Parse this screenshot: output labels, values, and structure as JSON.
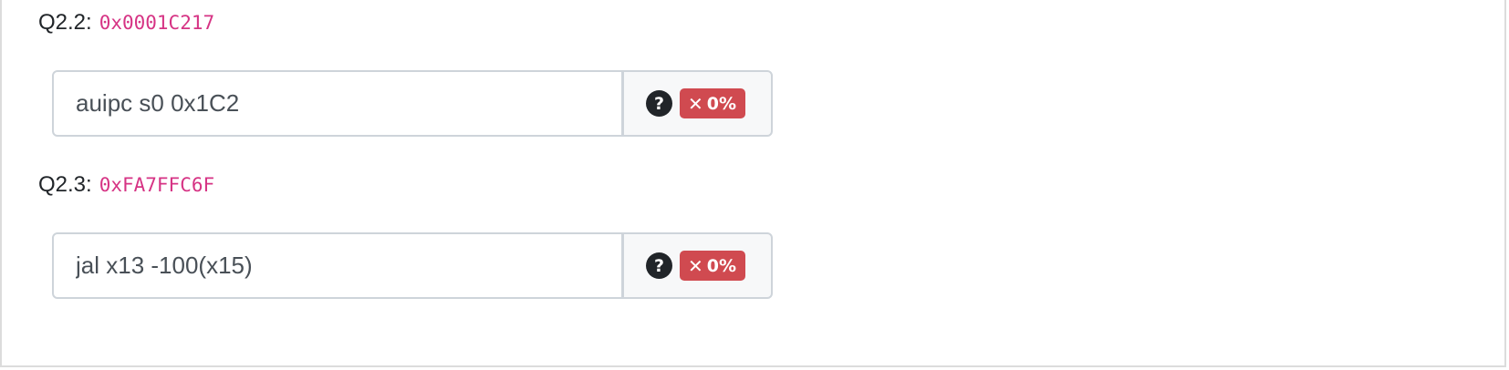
{
  "questions": [
    {
      "label": "Q2.2:",
      "code": "0x0001C217",
      "answer": "auipc s0 0x1C2",
      "help_icon": "question-circle-icon",
      "score_icon": "x-icon",
      "score_symbol": "✕",
      "score": "0%"
    },
    {
      "label": "Q2.3:",
      "code": "0xFA7FFC6F",
      "answer": "jal x13 -100(x15)",
      "help_icon": "question-circle-icon",
      "score_icon": "x-icon",
      "score_symbol": "✕",
      "score": "0%"
    }
  ],
  "help_symbol": "?",
  "colors": {
    "code": "#d63384",
    "badge_error": "#d04a50",
    "addon_background": "#f7f8f9",
    "input_border": "#ced4da"
  }
}
